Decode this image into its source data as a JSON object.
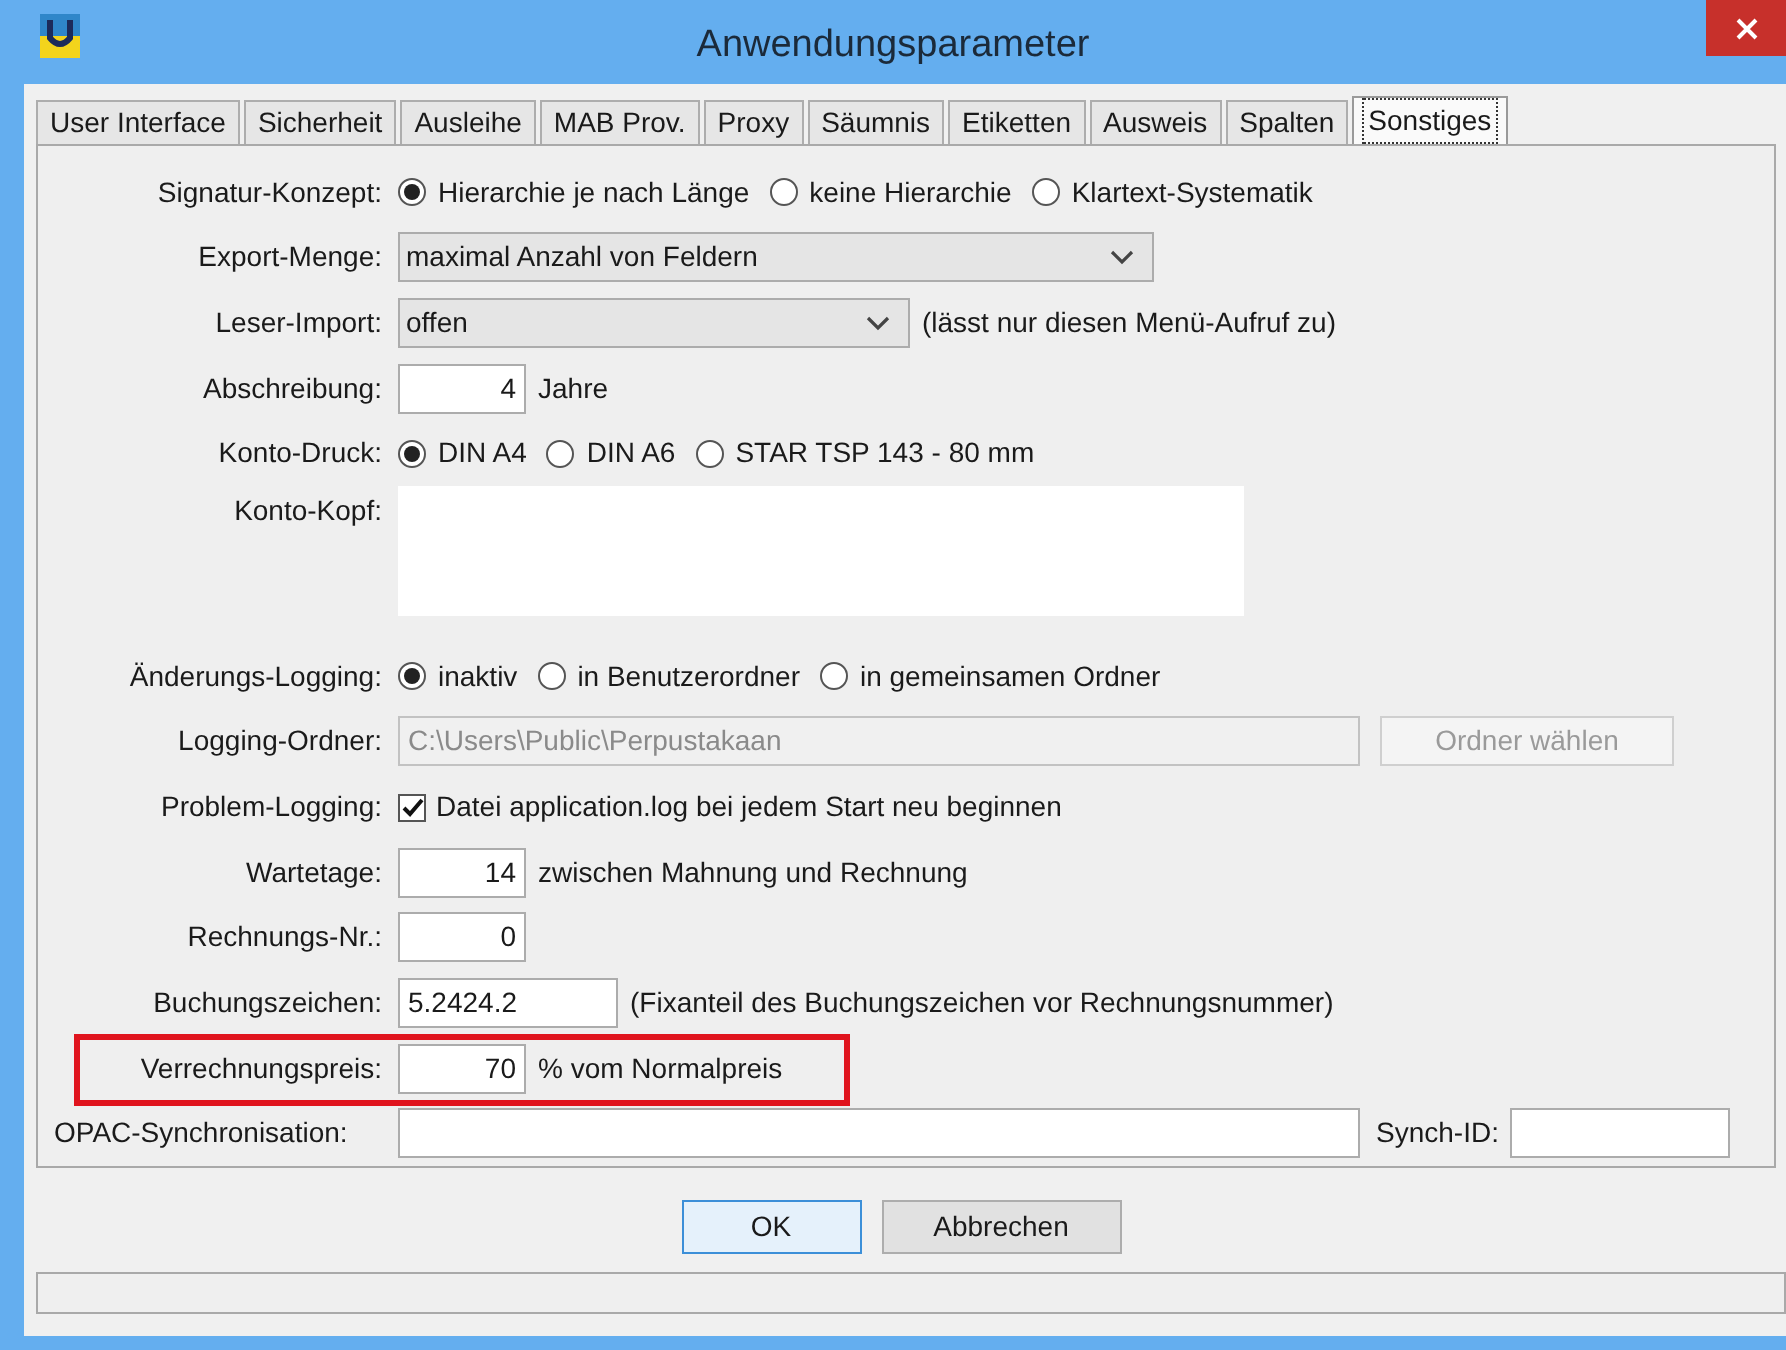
{
  "window": {
    "title": "Anwendungsparameter"
  },
  "tabs": [
    {
      "label": "User Interface",
      "selected": false
    },
    {
      "label": "Sicherheit",
      "selected": false
    },
    {
      "label": "Ausleihe",
      "selected": false
    },
    {
      "label": "MAB Prov.",
      "selected": false
    },
    {
      "label": "Proxy",
      "selected": false
    },
    {
      "label": "Säumnis",
      "selected": false
    },
    {
      "label": "Etiketten",
      "selected": false
    },
    {
      "label": "Ausweis",
      "selected": false
    },
    {
      "label": "Spalten",
      "selected": false
    },
    {
      "label": "Sonstiges",
      "selected": true
    }
  ],
  "fields": [
    {
      "kind": "radio",
      "label": "Signatur-Konzept:",
      "options": [
        {
          "label": "Hierarchie je nach Länge",
          "selected": true
        },
        {
          "label": "keine Hierarchie",
          "selected": false
        },
        {
          "label": "Klartext-Systematik",
          "selected": false
        }
      ]
    },
    {
      "kind": "select",
      "label": "Export-Menge:",
      "value": "maximal Anzahl von Feldern"
    },
    {
      "kind": "select",
      "label": "Leser-Import:",
      "value": "offen",
      "note": "(lässt nur diesen Menü-Aufruf zu)"
    },
    {
      "kind": "number",
      "label": "Abschreibung:",
      "value": "4",
      "note": "Jahre"
    },
    {
      "kind": "radio",
      "label": "Konto-Druck:",
      "options": [
        {
          "label": "DIN A4",
          "selected": true
        },
        {
          "label": "DIN A6",
          "selected": false
        },
        {
          "label": "STAR TSP 143 - 80 mm",
          "selected": false
        }
      ]
    },
    {
      "kind": "textarea",
      "label": "Konto-Kopf:"
    },
    {
      "kind": "radio",
      "label": "Änderungs-Logging:",
      "options": [
        {
          "label": "inaktiv",
          "selected": true
        },
        {
          "label": "in Benutzerordner",
          "selected": false
        },
        {
          "label": "in gemeinsamen Ordner",
          "selected": false
        }
      ]
    },
    {
      "kind": "path",
      "label": "Logging-Ordner:",
      "value": "C:\\Users\\Public\\Perpustakaan",
      "disabled": true,
      "button": {
        "label": "Ordner wählen",
        "disabled": true
      }
    },
    {
      "kind": "checkbox",
      "label": "Problem-Logging:",
      "text": "Datei application.log bei jedem Start neu beginnen",
      "checked": true
    },
    {
      "kind": "number",
      "label": "Wartetage:",
      "value": "14",
      "note": "zwischen Mahnung und Rechnung"
    },
    {
      "kind": "number",
      "label": "Rechnungs-Nr.:",
      "value": "0"
    },
    {
      "kind": "text",
      "label": "Buchungszeichen:",
      "value": "5.2424.2",
      "note": "(Fixanteil des Buchungszeichen vor Rechnungsnummer)"
    },
    {
      "kind": "number",
      "label": "Verrechnungspreis:",
      "value": "70",
      "note": "% vom Normalpreis",
      "highlighted": true
    },
    {
      "kind": "sync",
      "label": "OPAC-Synchronisation:",
      "extra_label": "Synch-ID:"
    }
  ],
  "buttons": [
    {
      "label": "OK",
      "focused": true
    },
    {
      "label": "Abbrechen",
      "focused": false
    }
  ]
}
